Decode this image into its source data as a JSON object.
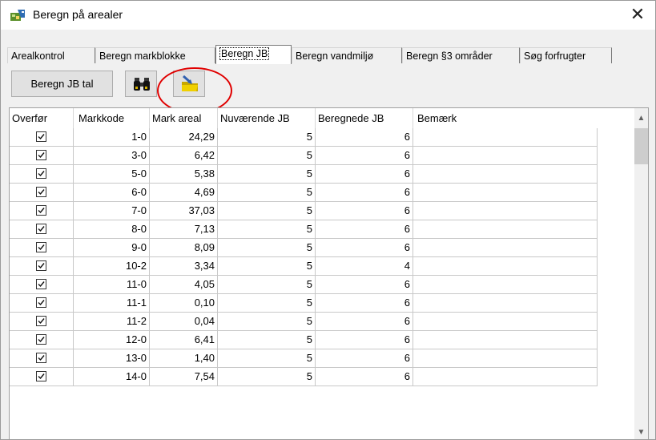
{
  "window": {
    "title": "Beregn på arealer",
    "close_glyph": "✕"
  },
  "tabs": [
    {
      "label": "Arealkontrol",
      "active": false
    },
    {
      "label": "Beregn markblokke",
      "active": false
    },
    {
      "label": "Beregn JB",
      "active": true
    },
    {
      "label": "Beregn vandmiljø",
      "active": false
    },
    {
      "label": "Beregn §3 områder",
      "active": false
    },
    {
      "label": "Søg forfrugter",
      "active": false
    }
  ],
  "toolbar": {
    "beregn_label": "Beregn JB tal",
    "find_icon": "binoculars-icon",
    "export_icon": "folder-arrow-icon"
  },
  "grid": {
    "columns": [
      "Overfør",
      "Markkode",
      "Mark areal",
      "Nuværende JB",
      "Beregnede JB",
      "Bemærk"
    ],
    "rows": [
      {
        "checked": true,
        "markkode": "1-0",
        "areal": "24,29",
        "nuv": "5",
        "ber": "6",
        "bem": ""
      },
      {
        "checked": true,
        "markkode": "3-0",
        "areal": "6,42",
        "nuv": "5",
        "ber": "6",
        "bem": ""
      },
      {
        "checked": true,
        "markkode": "5-0",
        "areal": "5,38",
        "nuv": "5",
        "ber": "6",
        "bem": ""
      },
      {
        "checked": true,
        "markkode": "6-0",
        "areal": "4,69",
        "nuv": "5",
        "ber": "6",
        "bem": ""
      },
      {
        "checked": true,
        "markkode": "7-0",
        "areal": "37,03",
        "nuv": "5",
        "ber": "6",
        "bem": ""
      },
      {
        "checked": true,
        "markkode": "8-0",
        "areal": "7,13",
        "nuv": "5",
        "ber": "6",
        "bem": ""
      },
      {
        "checked": true,
        "markkode": "9-0",
        "areal": "8,09",
        "nuv": "5",
        "ber": "6",
        "bem": ""
      },
      {
        "checked": true,
        "markkode": "10-2",
        "areal": "3,34",
        "nuv": "5",
        "ber": "4",
        "bem": ""
      },
      {
        "checked": true,
        "markkode": "11-0",
        "areal": "4,05",
        "nuv": "5",
        "ber": "6",
        "bem": ""
      },
      {
        "checked": true,
        "markkode": "11-1",
        "areal": "0,10",
        "nuv": "5",
        "ber": "6",
        "bem": ""
      },
      {
        "checked": true,
        "markkode": "11-2",
        "areal": "0,04",
        "nuv": "5",
        "ber": "6",
        "bem": ""
      },
      {
        "checked": true,
        "markkode": "12-0",
        "areal": "6,41",
        "nuv": "5",
        "ber": "6",
        "bem": ""
      },
      {
        "checked": true,
        "markkode": "13-0",
        "areal": "1,40",
        "nuv": "5",
        "ber": "6",
        "bem": ""
      },
      {
        "checked": true,
        "markkode": "14-0",
        "areal": "7,54",
        "nuv": "5",
        "ber": "6",
        "bem": ""
      }
    ]
  },
  "highlight": {
    "color": "#e00000"
  }
}
